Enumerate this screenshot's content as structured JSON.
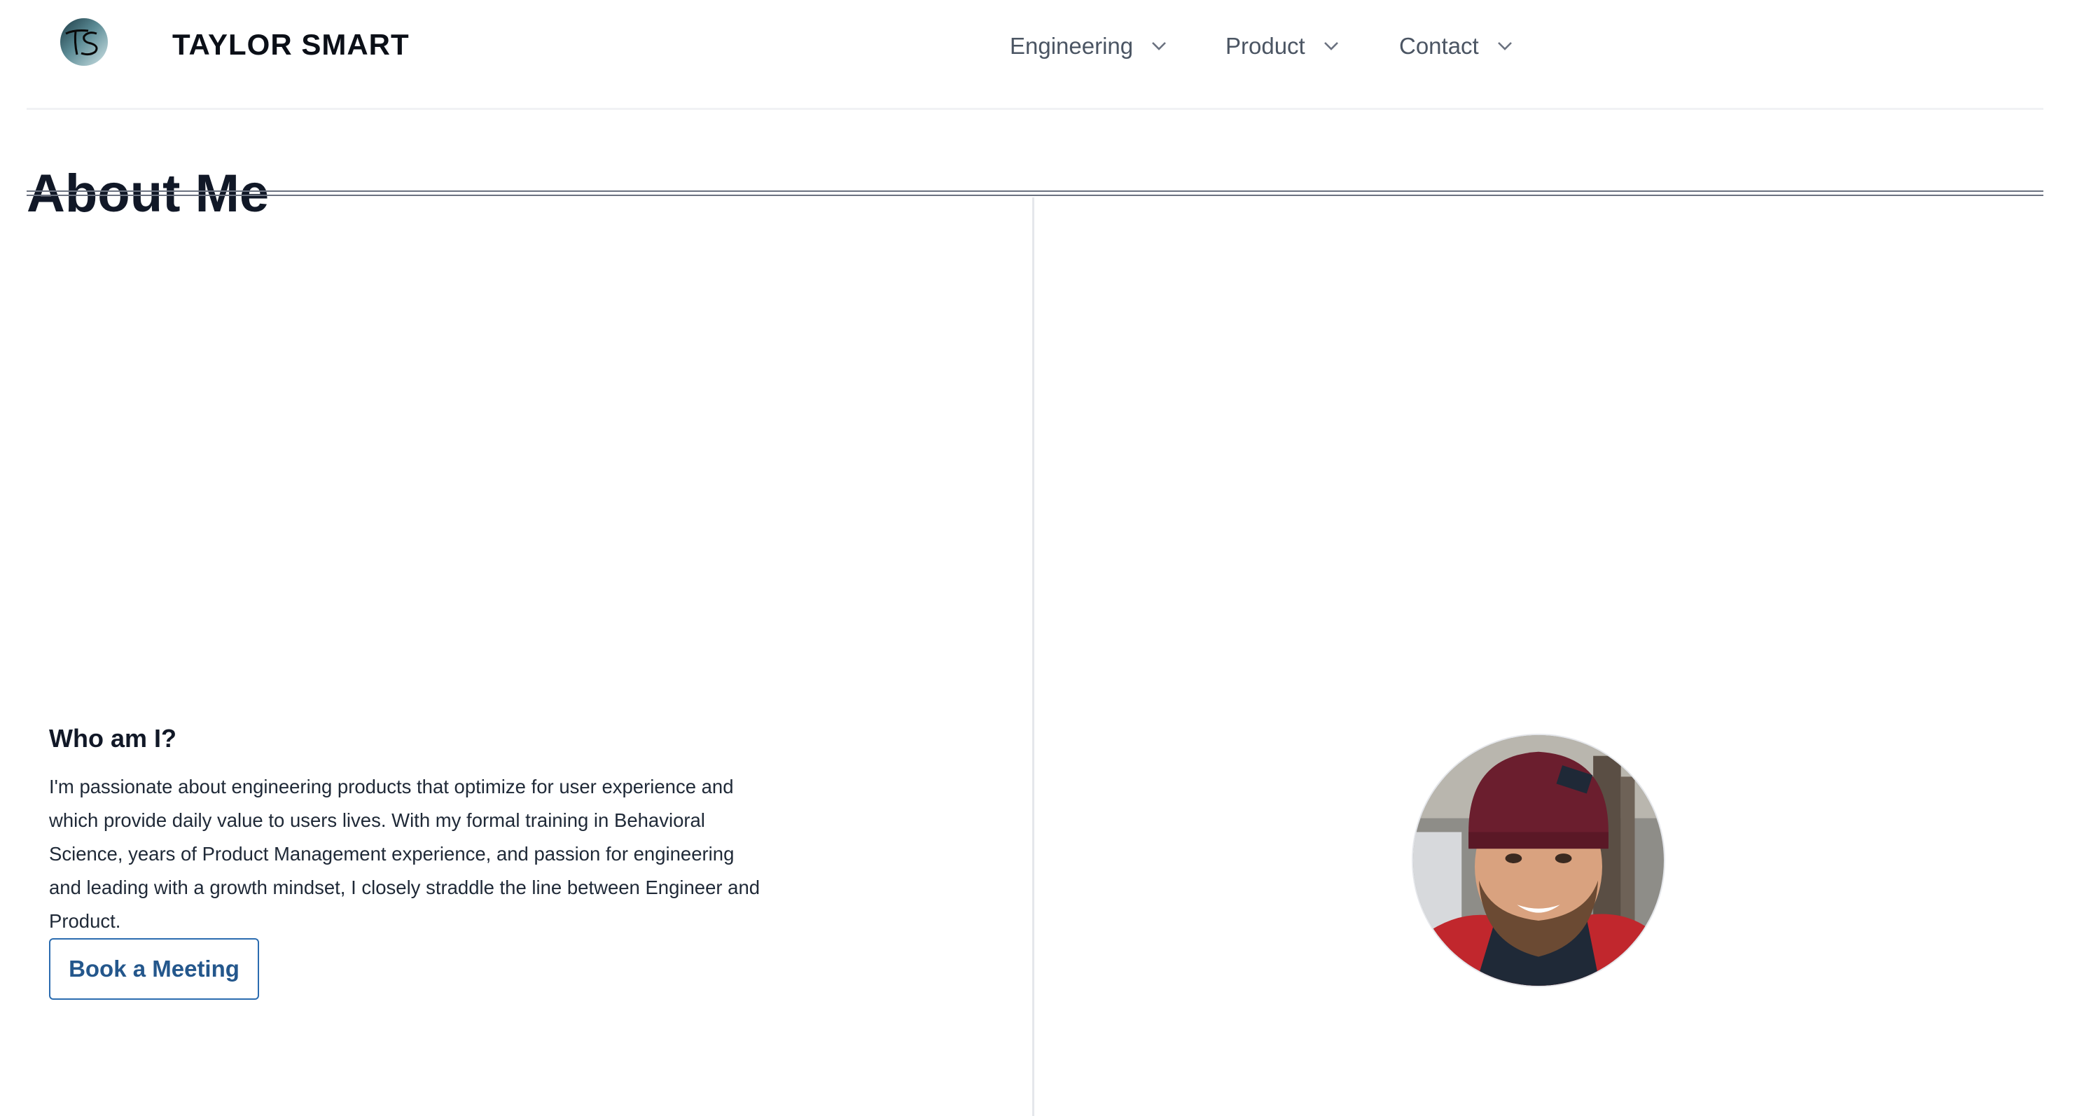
{
  "header": {
    "logo_text": "TS",
    "brand": "TAYLOR SMART",
    "nav": [
      {
        "label": "Engineering",
        "icon": "chevron-down-icon"
      },
      {
        "label": "Product",
        "icon": "chevron-down-icon"
      },
      {
        "label": "Contact",
        "icon": "chevron-down-icon"
      }
    ]
  },
  "main": {
    "title": "About Me",
    "who_heading": "Who am I?",
    "bio": "I'm passionate about engineering products that optimize for user experience and which provide daily value to users lives. With my formal training in Behavioral Science, years of Product Management experience, and passion for engineering and leading with a growth mindset, I closely straddle the line between Engineer and Product.",
    "cta_label": "Book a Meeting"
  },
  "colors": {
    "accent": "#2b6cb0",
    "nav_text": "#4b5563",
    "title": "#111827"
  }
}
